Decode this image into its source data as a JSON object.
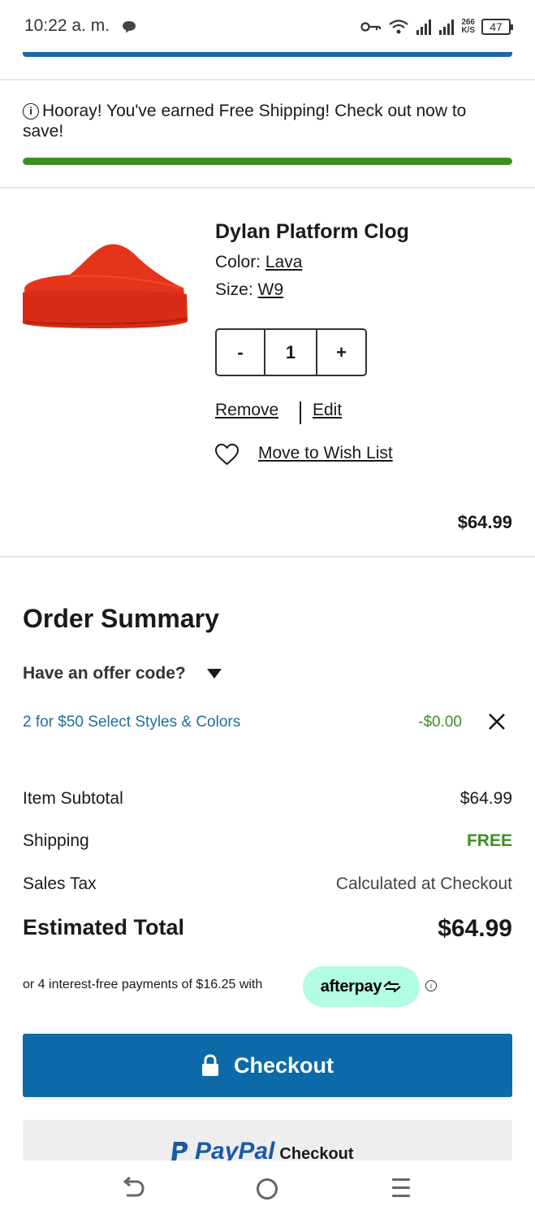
{
  "status_bar": {
    "time": "10:22 a. m.",
    "speed_value": "266",
    "speed_unit": "K/S",
    "battery": "47"
  },
  "banner": {
    "message": "Hooray! You've earned Free Shipping! Check out now to save!",
    "progress_percent": 100,
    "progress_color": "#3f8e23"
  },
  "product": {
    "name": "Dylan Platform Clog",
    "color_label": "Color:",
    "color_value": "Lava",
    "size_label": "Size:",
    "size_value": "W9",
    "qty_minus": "-",
    "quantity": "1",
    "qty_plus": "+",
    "remove": "Remove",
    "edit": "Edit",
    "wishlist": "Move to Wish List",
    "price": "$64.99",
    "image_color": "#e23a1d"
  },
  "summary": {
    "title": "Order Summary",
    "offer_toggle": "Have an offer code?",
    "promo_name": "2 for $50 Select Styles & Colors",
    "promo_amount": "-$0.00",
    "subtotal_label": "Item Subtotal",
    "subtotal_value": "$64.99",
    "shipping_label": "Shipping",
    "shipping_value": "FREE",
    "tax_label": "Sales Tax",
    "tax_value": "Calculated at Checkout",
    "total_label": "Estimated Total",
    "total_value": "$64.99"
  },
  "afterpay": {
    "text": "or 4 interest-free payments of $16.25 with",
    "brand": "afterpay",
    "info": "i"
  },
  "buttons": {
    "checkout": "Checkout",
    "paypal_brand": "PayPal",
    "paypal_label": "Checkout"
  },
  "colors": {
    "accent_blue": "#0b6aa7",
    "promo_link": "#1f6e9e",
    "success_green": "#3f8e23",
    "afterpay_mint": "#b2fce4"
  }
}
